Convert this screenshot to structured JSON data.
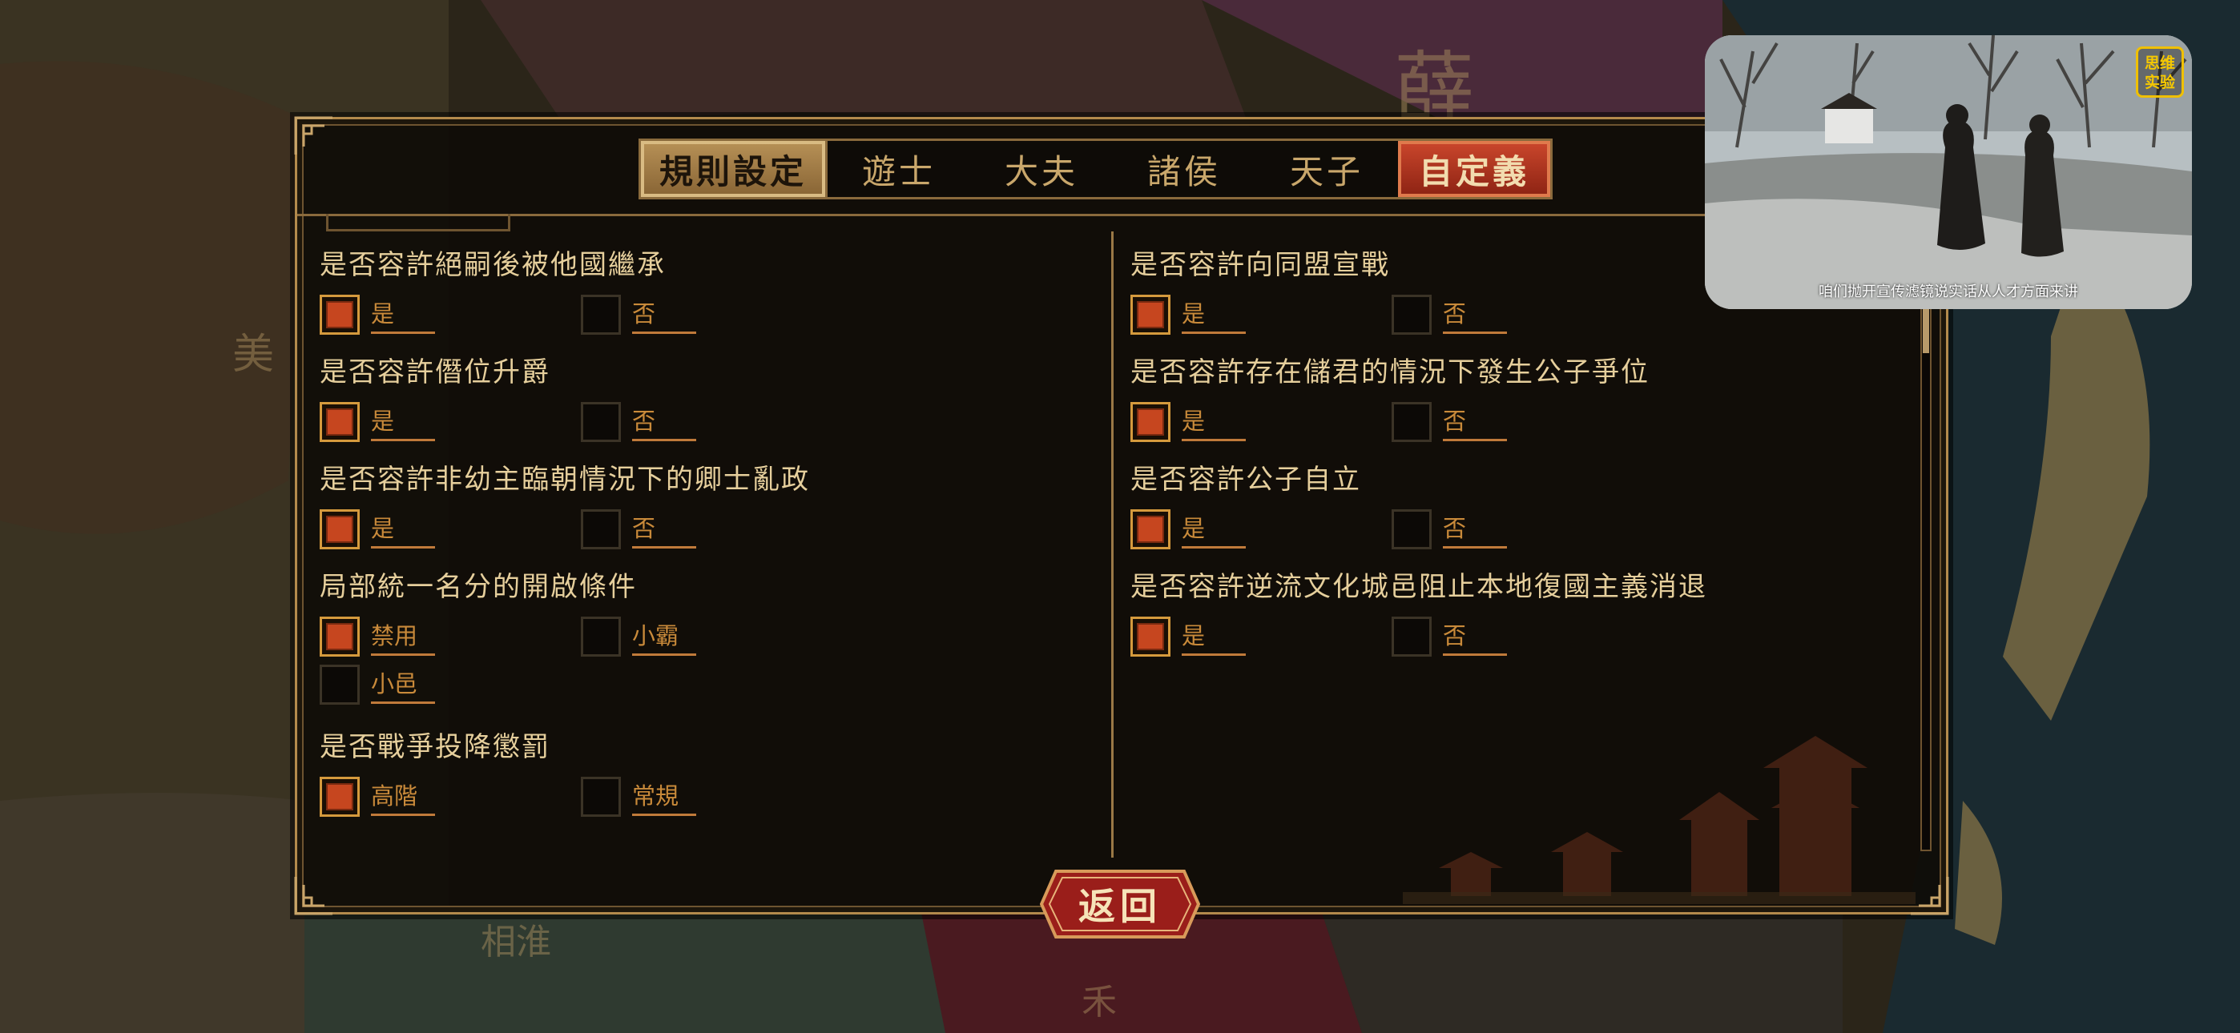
{
  "tabs": {
    "rules_setting": "規則設定",
    "youshi": "遊士",
    "dafu": "大夫",
    "zhuhou": "諸侯",
    "tianzi": "天子",
    "custom": "自定義"
  },
  "left_rules": [
    {
      "title": "是否容許絕嗣後被他國繼承",
      "options": [
        {
          "label": "是",
          "checked": true
        },
        {
          "label": "否",
          "checked": false
        }
      ]
    },
    {
      "title": "是否容許僭位升爵",
      "options": [
        {
          "label": "是",
          "checked": true
        },
        {
          "label": "否",
          "checked": false
        }
      ]
    },
    {
      "title": "是否容許非幼主臨朝情況下的卿士亂政",
      "options": [
        {
          "label": "是",
          "checked": true
        },
        {
          "label": "否",
          "checked": false
        }
      ]
    },
    {
      "title": "局部統一名分的開啟條件",
      "options": [
        {
          "label": "禁用",
          "checked": true
        },
        {
          "label": "小霸",
          "checked": false
        },
        {
          "label": "小邑",
          "checked": false
        }
      ]
    },
    {
      "title": "是否戰爭投降懲罰",
      "options": [
        {
          "label": "高階",
          "checked": true
        },
        {
          "label": "常規",
          "checked": false
        }
      ]
    }
  ],
  "right_rules": [
    {
      "title": "是否容許向同盟宣戰",
      "options": [
        {
          "label": "是",
          "checked": true
        },
        {
          "label": "否",
          "checked": false
        }
      ]
    },
    {
      "title": "是否容許存在儲君的情況下發生公子爭位",
      "options": [
        {
          "label": "是",
          "checked": true
        },
        {
          "label": "否",
          "checked": false
        }
      ]
    },
    {
      "title": "是否容許公子自立",
      "options": [
        {
          "label": "是",
          "checked": true
        },
        {
          "label": "否",
          "checked": false
        }
      ]
    },
    {
      "title": "是否容許逆流文化城邑阻止本地復國主義消退",
      "options": [
        {
          "label": "是",
          "checked": true
        },
        {
          "label": "否",
          "checked": false
        }
      ]
    }
  ],
  "back_button": "返回",
  "scroll_position": 0.0,
  "map_labels": {
    "top": "薛",
    "left": "美",
    "bottom_left": "相淮",
    "bottom": "禾"
  },
  "pip": {
    "caption": "咱们抛开宣传滤镜说实话从人才方面来讲",
    "badge": "思维实验"
  },
  "colors": {
    "accent_gold": "#b38a4c",
    "checked_red": "#c6461f",
    "custom_tab": "#c8452b",
    "option_text": "#c98a3a"
  }
}
